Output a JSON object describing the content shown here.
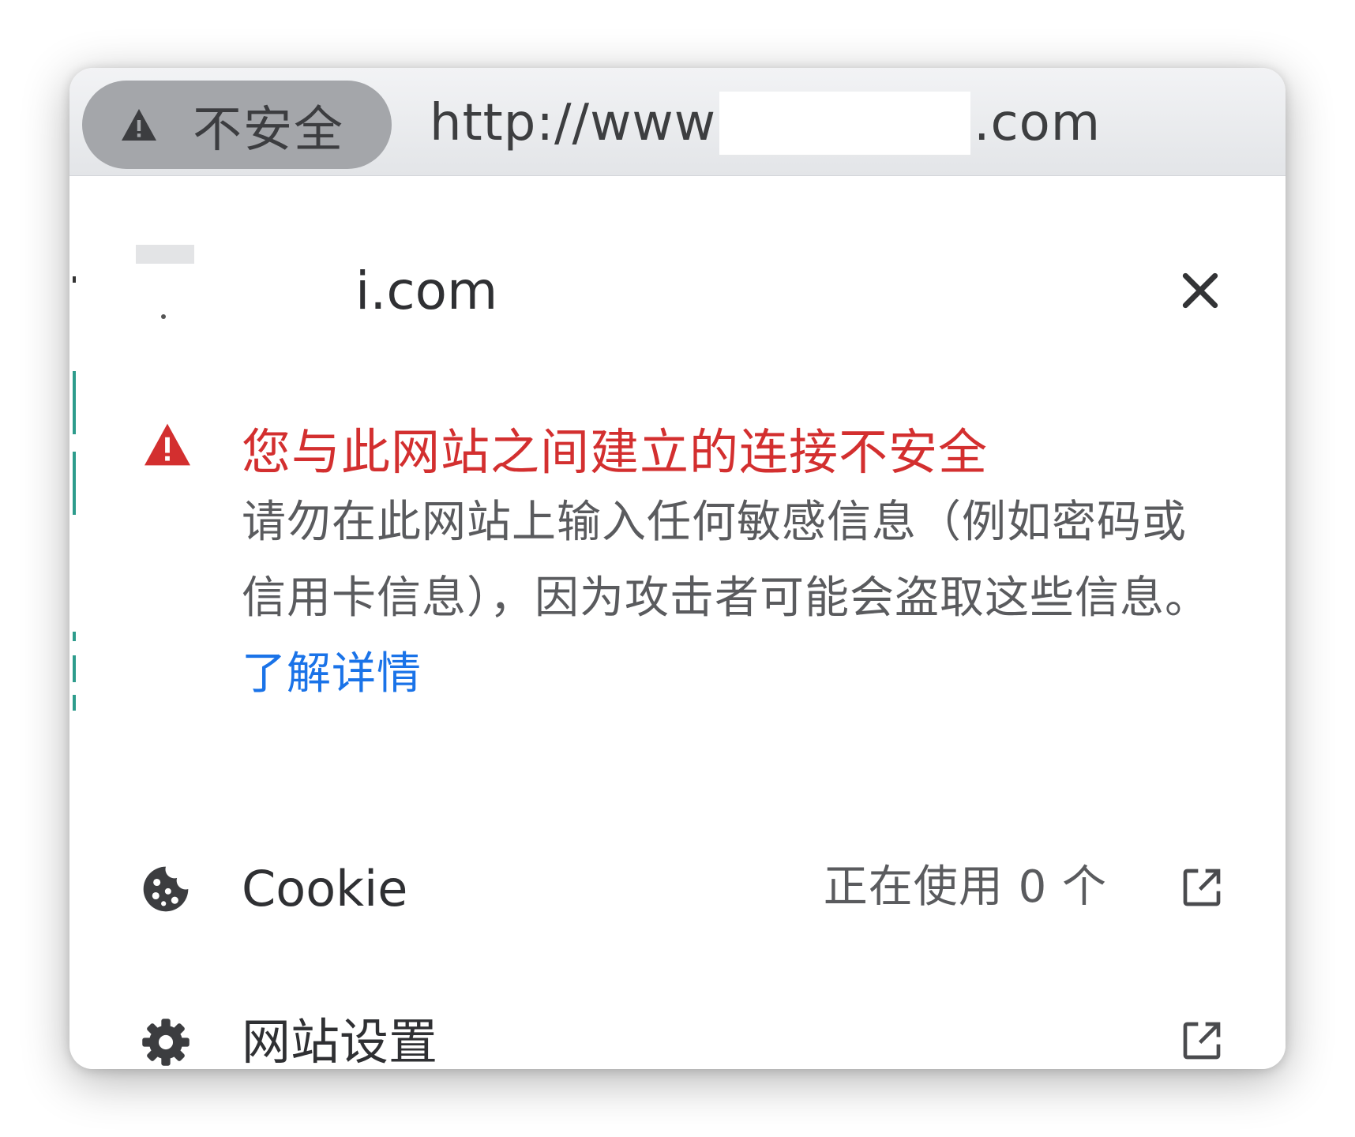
{
  "address_bar": {
    "security_chip_icon": "warning-triangle-icon",
    "security_chip_label": "不安全",
    "url_prefix": "http://www",
    "url_suffix": ".com"
  },
  "popup": {
    "site_domain": "i.com",
    "close_icon": "close-icon",
    "warning": {
      "icon": "warning-triangle-icon",
      "title": "您与此网站之间建立的连接不安全",
      "body": "请勿在此网站上输入任何敏感信息（例如密码或信用卡信息），因为攻击者可能会盗取这些信息。",
      "learn_more": "了解详情",
      "title_color": "#d32f2f",
      "link_color": "#1a73e8"
    },
    "rows": [
      {
        "icon": "cookie-icon",
        "label": "Cookie",
        "value": "正在使用 0 个",
        "action_icon": "open-external-icon"
      },
      {
        "icon": "gear-icon",
        "label": "网站设置",
        "value": "",
        "action_icon": "open-external-icon"
      }
    ]
  }
}
